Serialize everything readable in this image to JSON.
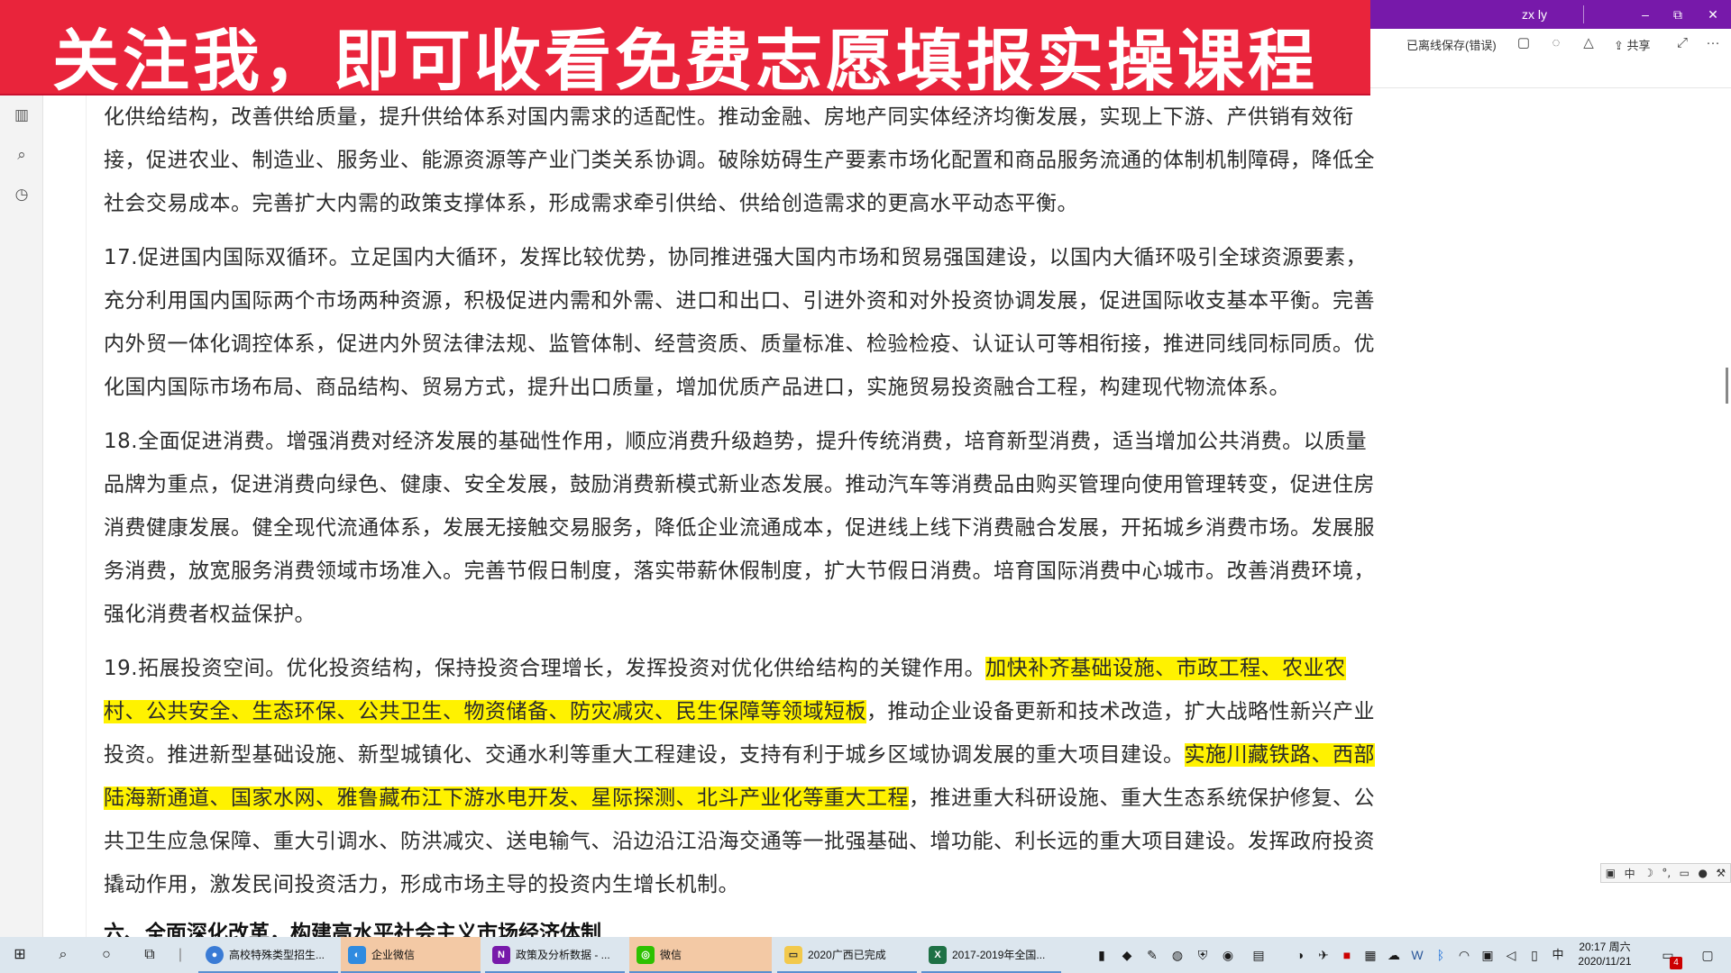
{
  "banner": {
    "text": "关注我，即可收看免费志愿填报实操课程"
  },
  "titlebar": {
    "user": "zx ly",
    "minimize": "–",
    "restore": "⧉",
    "close": "✕"
  },
  "ribbon": {
    "save_status": "已离线保存(错误)",
    "share_label": "共享",
    "icons": {
      "a": "▢",
      "b": "♀",
      "c": "🔔",
      "d": "⤢",
      "e": "···"
    }
  },
  "rail": {
    "icons": [
      "library-icon",
      "search-icon",
      "history-icon"
    ]
  },
  "document": {
    "p16_tail": [
      "化供给结构，改善供给质量，提升供给体系对国内需求的适配性。推动金融、房地产同实体经济均衡发展，实现上下游、产供销有效衔",
      "接，促进农业、制造业、服务业、能源资源等产业门类关系协调。破除妨碍生产要素市场化配置和商品服务流通的体制机制障碍，降低全",
      "社会交易成本。完善扩大内需的政策支撑体系，形成需求牵引供给、供给创造需求的更高水平动态平衡。"
    ],
    "p17": [
      "17.促进国内国际双循环。立足国内大循环，发挥比较优势，协同推进强大国内市场和贸易强国建设，以国内大循环吸引全球资源要素，",
      "充分利用国内国际两个市场两种资源，积极促进内需和外需、进口和出口、引进外资和对外投资协调发展，促进国际收支基本平衡。完善",
      "内外贸一体化调控体系，促进内外贸法律法规、监管体制、经营资质、质量标准、检验检疫、认证认可等相衔接，推进同线同标同质。优",
      "化国内国际市场布局、商品结构、贸易方式，提升出口质量，增加优质产品进口，实施贸易投资融合工程，构建现代物流体系。"
    ],
    "p18": [
      "18.全面促进消费。增强消费对经济发展的基础性作用，顺应消费升级趋势，提升传统消费，培育新型消费，适当增加公共消费。以质量",
      "品牌为重点，促进消费向绿色、健康、安全发展，鼓励消费新模式新业态发展。推动汽车等消费品由购买管理向使用管理转变，促进住房",
      "消费健康发展。健全现代流通体系，发展无接触交易服务，降低企业流通成本，促进线上线下消费融合发展，开拓城乡消费市场。发展服",
      "务消费，放宽服务消费领域市场准入。完善节假日制度，落实带薪休假制度，扩大节假日消费。培育国际消费中心城市。改善消费环境，",
      "强化消费者权益保护。"
    ],
    "p19": {
      "l1_plain": "19.拓展投资空间。优化投资结构，保持投资合理增长，发挥投资对优化供给结构的关键作用。",
      "l1_hl": "加快补齐基础设施、市政工程、农业农",
      "l2_hl": "村、公共安全、生态环保、公共卫生、物资储备、防灾减灾、民生保障等领域短板",
      "l2_plain": "，推动企业设备更新和技术改造，扩大战略性新兴产业",
      "l3_plain": "投资。推进新型基础设施、新型城镇化、交通水利等重大工程建设，支持有利于城乡区域协调发展的重大项目建设。",
      "l3_hl": "实施川藏铁路、西部",
      "l4_hl": "陆海新通道、国家水网、雅鲁藏布江下游水电开发、星际探测、北斗产业化等重大工程",
      "l4_plain": "，推进重大科研设施、重大生态系统保护修复、公",
      "l5_plain": "共卫生应急保障、重大引调水、防洪减灾、送电输气、沿边沿江沿海交通等一批强基础、增功能、利长远的重大项目建设。发挥政府投资",
      "l6_plain": "撬动作用，激发民间投资活力，形成市场主导的投资内生增长机制。"
    },
    "heading": "六、全面深化改革，构建高水平社会主义市场经济体制"
  },
  "ime": {
    "label": "中"
  },
  "taskbar": {
    "tasks": [
      {
        "label": "高校特殊类型招生..."
      },
      {
        "label": "企业微信"
      },
      {
        "label": "政策及分析数据 - ..."
      },
      {
        "label": "微信"
      },
      {
        "label": "2020广西已完成"
      },
      {
        "label": "2017-2019年全国..."
      }
    ],
    "time": "20:17 周六",
    "date": "2020/11/21",
    "notif_count": "4"
  }
}
